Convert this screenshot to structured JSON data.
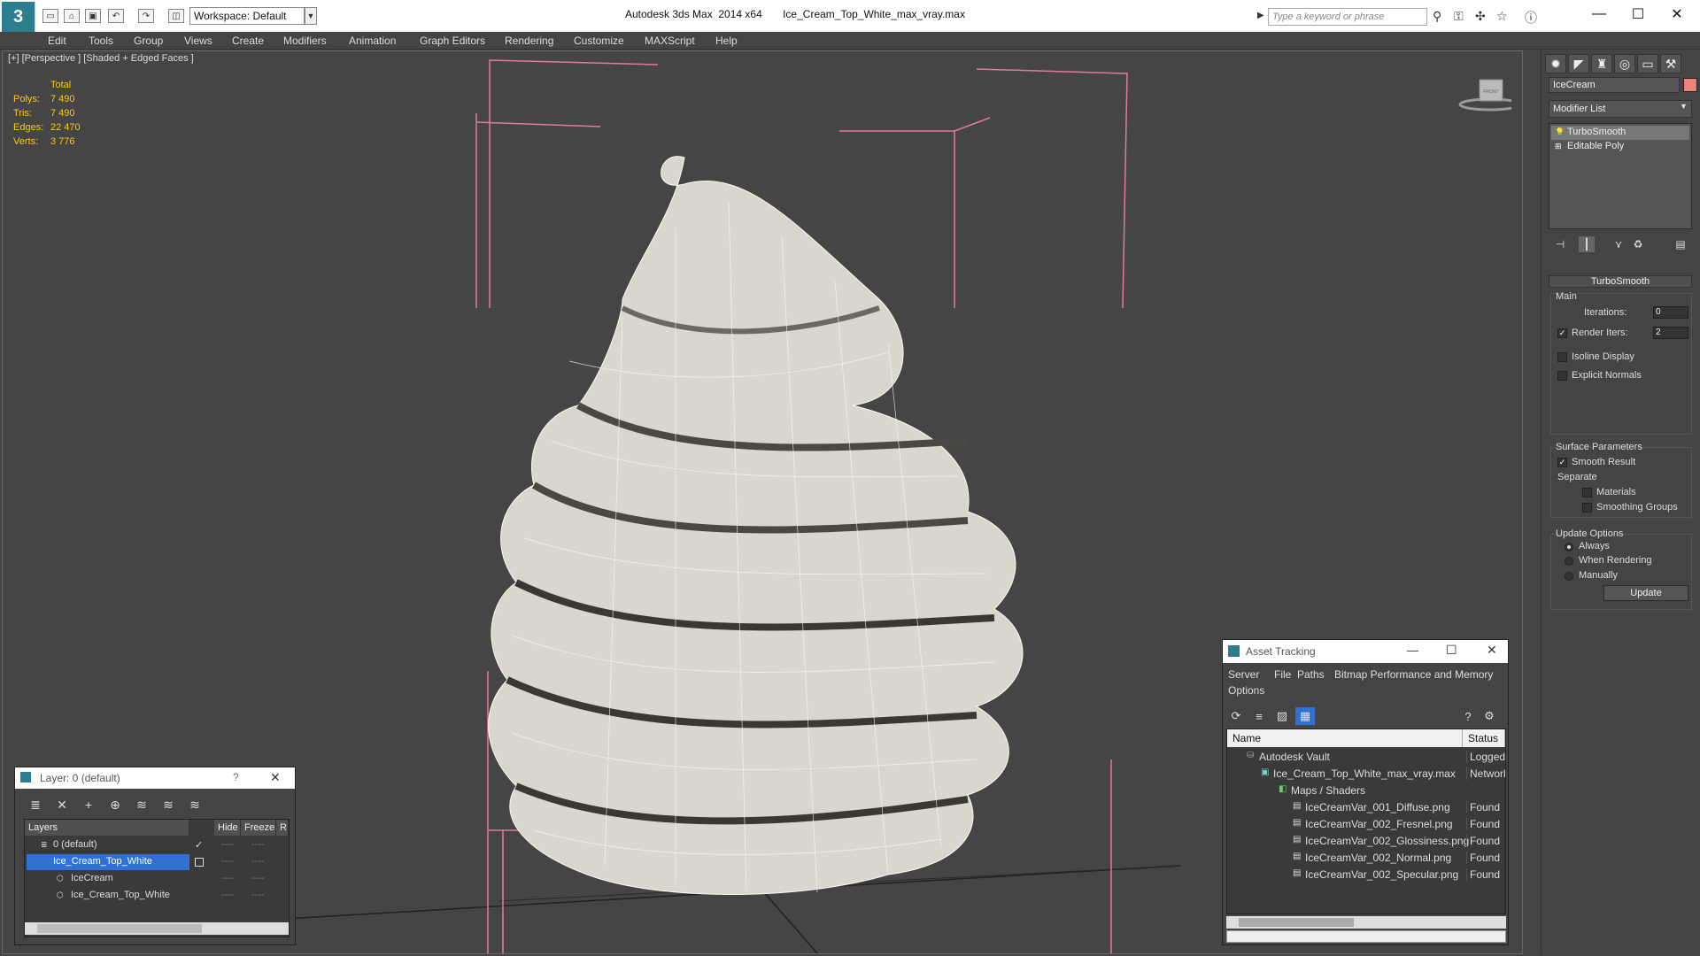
{
  "titlebar": {
    "logo": "3",
    "workspace": "Workspace: Default",
    "app_title": "Autodesk 3ds Max  2014 x64       Ice_Cream_Top_White_max_vray.max",
    "search_placeholder": "Type a keyword or phrase",
    "minimize": "—",
    "maximize": "☐",
    "close": "✕"
  },
  "menu": [
    "Edit",
    "Tools",
    "Group",
    "Views",
    "Create",
    "Modifiers",
    "Animation",
    "Graph Editors",
    "Rendering",
    "Customize",
    "MAXScript",
    "Help"
  ],
  "viewport": {
    "label": "[+] [Perspective ] [Shaded + Edged Faces ]",
    "stats": {
      "header": "Total",
      "polys_label": "Polys:",
      "polys": "7 490",
      "tris_label": "Tris:",
      "tris": "7 490",
      "edges_label": "Edges:",
      "edges": "22 470",
      "verts_label": "Verts:",
      "verts": "3 776"
    },
    "viewcube_label": "FRONT"
  },
  "command_panel": {
    "object_name": "IceCream",
    "object_color": "#f08080",
    "modifier_list": "Modifier List",
    "stack": [
      {
        "label": "TurboSmooth",
        "icon": "lightbulb-icon"
      },
      {
        "label": "Editable Poly",
        "icon": "plus-box-icon"
      }
    ],
    "rollout_title": "TurboSmooth",
    "main_label": "Main",
    "iterations_label": "Iterations:",
    "iterations": "0",
    "render_iters_label": "Render Iters:",
    "render_iters": "2",
    "isoline_label": "Isoline Display",
    "explicit_normals_label": "Explicit Normals",
    "surface_label": "Surface Parameters",
    "smooth_result_label": "Smooth Result",
    "separate_label": "Separate",
    "materials_label": "Materials",
    "smoothing_groups_label": "Smoothing Groups",
    "update_options_label": "Update Options",
    "always_label": "Always",
    "when_rendering_label": "When Rendering",
    "manually_label": "Manually",
    "update_button": "Update"
  },
  "layer_dialog": {
    "title": "Layer: 0 (default)",
    "help": "?",
    "close": "✕",
    "headers": {
      "layers": "Layers",
      "hide": "Hide",
      "freeze": "Freeze",
      "render": "R"
    },
    "rows": [
      {
        "name": "0 (default)",
        "check": "✓"
      },
      {
        "name": "Ice_Cream_Top_White"
      },
      {
        "name": "IceCream"
      },
      {
        "name": "Ice_Cream_Top_White"
      }
    ],
    "dash": "----"
  },
  "asset_tracking": {
    "title": "Asset Tracking",
    "menus": [
      "Server",
      "File",
      "Paths",
      "Bitmap Performance and Memory",
      "Options"
    ],
    "headers": {
      "name": "Name",
      "status": "Status"
    },
    "rows": [
      {
        "name": "Autodesk Vault",
        "status": "Logged O"
      },
      {
        "name": "Ice_Cream_Top_White_max_vray.max",
        "status": "Network"
      },
      {
        "name": "Maps / Shaders",
        "status": ""
      },
      {
        "name": "IceCreamVar_001_Diffuse.png",
        "status": "Found"
      },
      {
        "name": "IceCreamVar_002_Fresnel.png",
        "status": "Found"
      },
      {
        "name": "IceCreamVar_002_Glossiness.png",
        "status": "Found"
      },
      {
        "name": "IceCreamVar_002_Normal.png",
        "status": "Found"
      },
      {
        "name": "IceCreamVar_002_Specular.png",
        "status": "Found"
      }
    ]
  }
}
